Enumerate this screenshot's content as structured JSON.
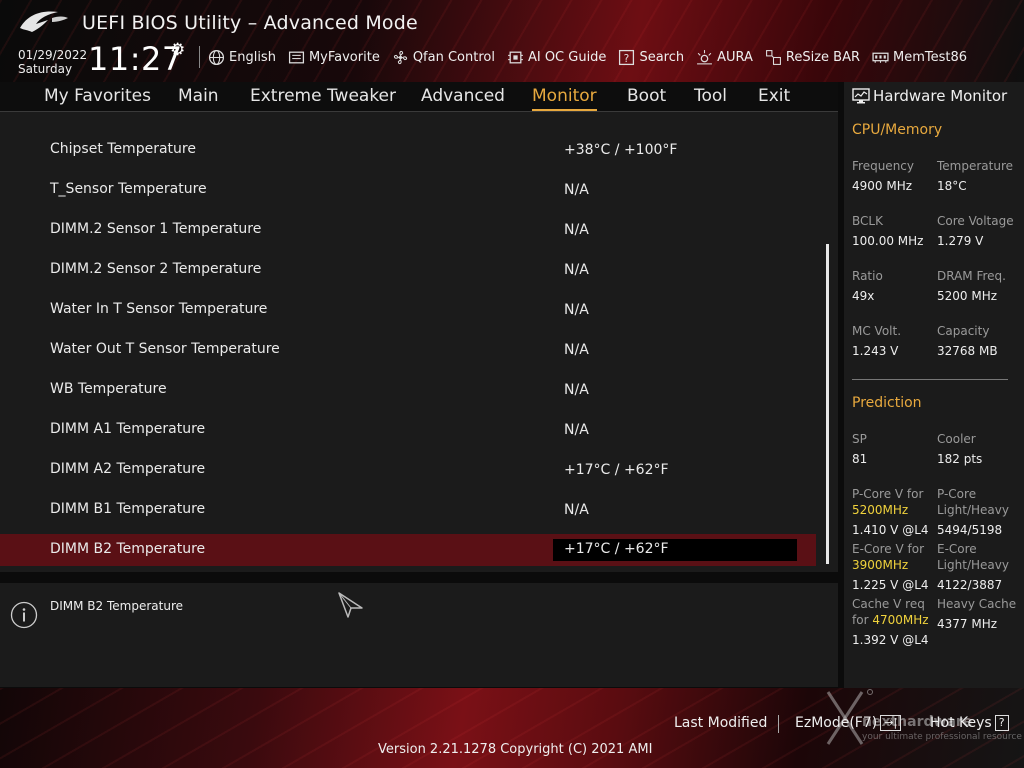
{
  "header": {
    "title": "UEFI BIOS Utility – Advanced Mode",
    "date": "01/29/2022",
    "day": "Saturday",
    "time": "11:27",
    "tools": [
      {
        "label": "English",
        "icon": "globe-icon"
      },
      {
        "label": "MyFavorite",
        "icon": "favorite-icon"
      },
      {
        "label": "Qfan Control",
        "icon": "fan-icon"
      },
      {
        "label": "AI OC Guide",
        "icon": "ai-oc-icon"
      },
      {
        "label": "Search",
        "icon": "search-help-icon"
      },
      {
        "label": "AURA",
        "icon": "aura-icon"
      },
      {
        "label": "ReSize BAR",
        "icon": "resize-bar-icon"
      },
      {
        "label": "MemTest86",
        "icon": "memtest-icon"
      }
    ]
  },
  "nav": {
    "tabs": [
      "My Favorites",
      "Main",
      "Extreme Tweaker",
      "Advanced",
      "Monitor",
      "Boot",
      "Tool",
      "Exit"
    ],
    "active": "Monitor"
  },
  "main": {
    "rows": [
      {
        "label": "Chipset Temperature",
        "value": "+38°C / +100°F"
      },
      {
        "label": "T_Sensor Temperature",
        "value": "N/A"
      },
      {
        "label": "DIMM.2 Sensor 1 Temperature",
        "value": "N/A"
      },
      {
        "label": "DIMM.2 Sensor 2 Temperature",
        "value": "N/A"
      },
      {
        "label": "Water In T Sensor Temperature",
        "value": "N/A"
      },
      {
        "label": "Water Out T Sensor Temperature",
        "value": "N/A"
      },
      {
        "label": "WB Temperature",
        "value": "N/A"
      },
      {
        "label": "DIMM A1 Temperature",
        "value": "N/A"
      },
      {
        "label": "DIMM A2 Temperature",
        "value": "+17°C / +62°F"
      },
      {
        "label": "DIMM B1 Temperature",
        "value": "N/A"
      },
      {
        "label": "DIMM B2 Temperature",
        "value": "+17°C / +62°F"
      }
    ],
    "selected_index": 10
  },
  "help": {
    "text": "DIMM B2 Temperature"
  },
  "hardware_monitor": {
    "title": "Hardware Monitor",
    "cpu_memory": {
      "title": "CPU/Memory",
      "items": [
        {
          "key": "Frequency",
          "value": "4900 MHz"
        },
        {
          "key": "Temperature",
          "value": "18°C"
        },
        {
          "key": "BCLK",
          "value": "100.00 MHz"
        },
        {
          "key": "Core Voltage",
          "value": "1.279 V"
        },
        {
          "key": "Ratio",
          "value": "49x"
        },
        {
          "key": "DRAM Freq.",
          "value": "5200 MHz"
        },
        {
          "key": "MC Volt.",
          "value": "1.243 V"
        },
        {
          "key": "Capacity",
          "value": "32768 MB"
        }
      ]
    },
    "prediction": {
      "title": "Prediction",
      "sp_label": "SP",
      "sp_value": "81",
      "cooler_label": "Cooler",
      "cooler_value": "182 pts",
      "pcore_v_label": "P-Core V for",
      "pcore_v_freq": "5200MHz",
      "pcore_v_value": "1.410 V @L4",
      "pcore_lh_label1": "P-Core",
      "pcore_lh_label2": "Light/Heavy",
      "pcore_lh_value": "5494/5198",
      "ecore_v_label": "E-Core V for",
      "ecore_v_freq": "3900MHz",
      "ecore_v_value": "1.225 V @L4",
      "ecore_lh_label1": "E-Core",
      "ecore_lh_label2": "Light/Heavy",
      "ecore_lh_value": "4122/3887",
      "cache_v_label1": "Cache V req",
      "cache_v_label2": "for",
      "cache_v_freq": "4700MHz",
      "cache_v_value": "1.392 V @L4",
      "heavy_cache_label": "Heavy Cache",
      "heavy_cache_value": "4377 MHz"
    }
  },
  "footer": {
    "last_modified": "Last Modified",
    "ezmode": "EzMode(F7)",
    "ezmode_key": "→|",
    "hot_keys": "Hot Keys",
    "hot_keys_key": "?",
    "version": "Version 2.21.1278 Copyright (C) 2021 AMI",
    "watermark": "nexthardware",
    "watermark_sub": "your ultimate professional resource"
  },
  "colors": {
    "accent": "#e8a93e",
    "selected_row": "#5a1015",
    "highlight_freq": "#f0d23c"
  }
}
